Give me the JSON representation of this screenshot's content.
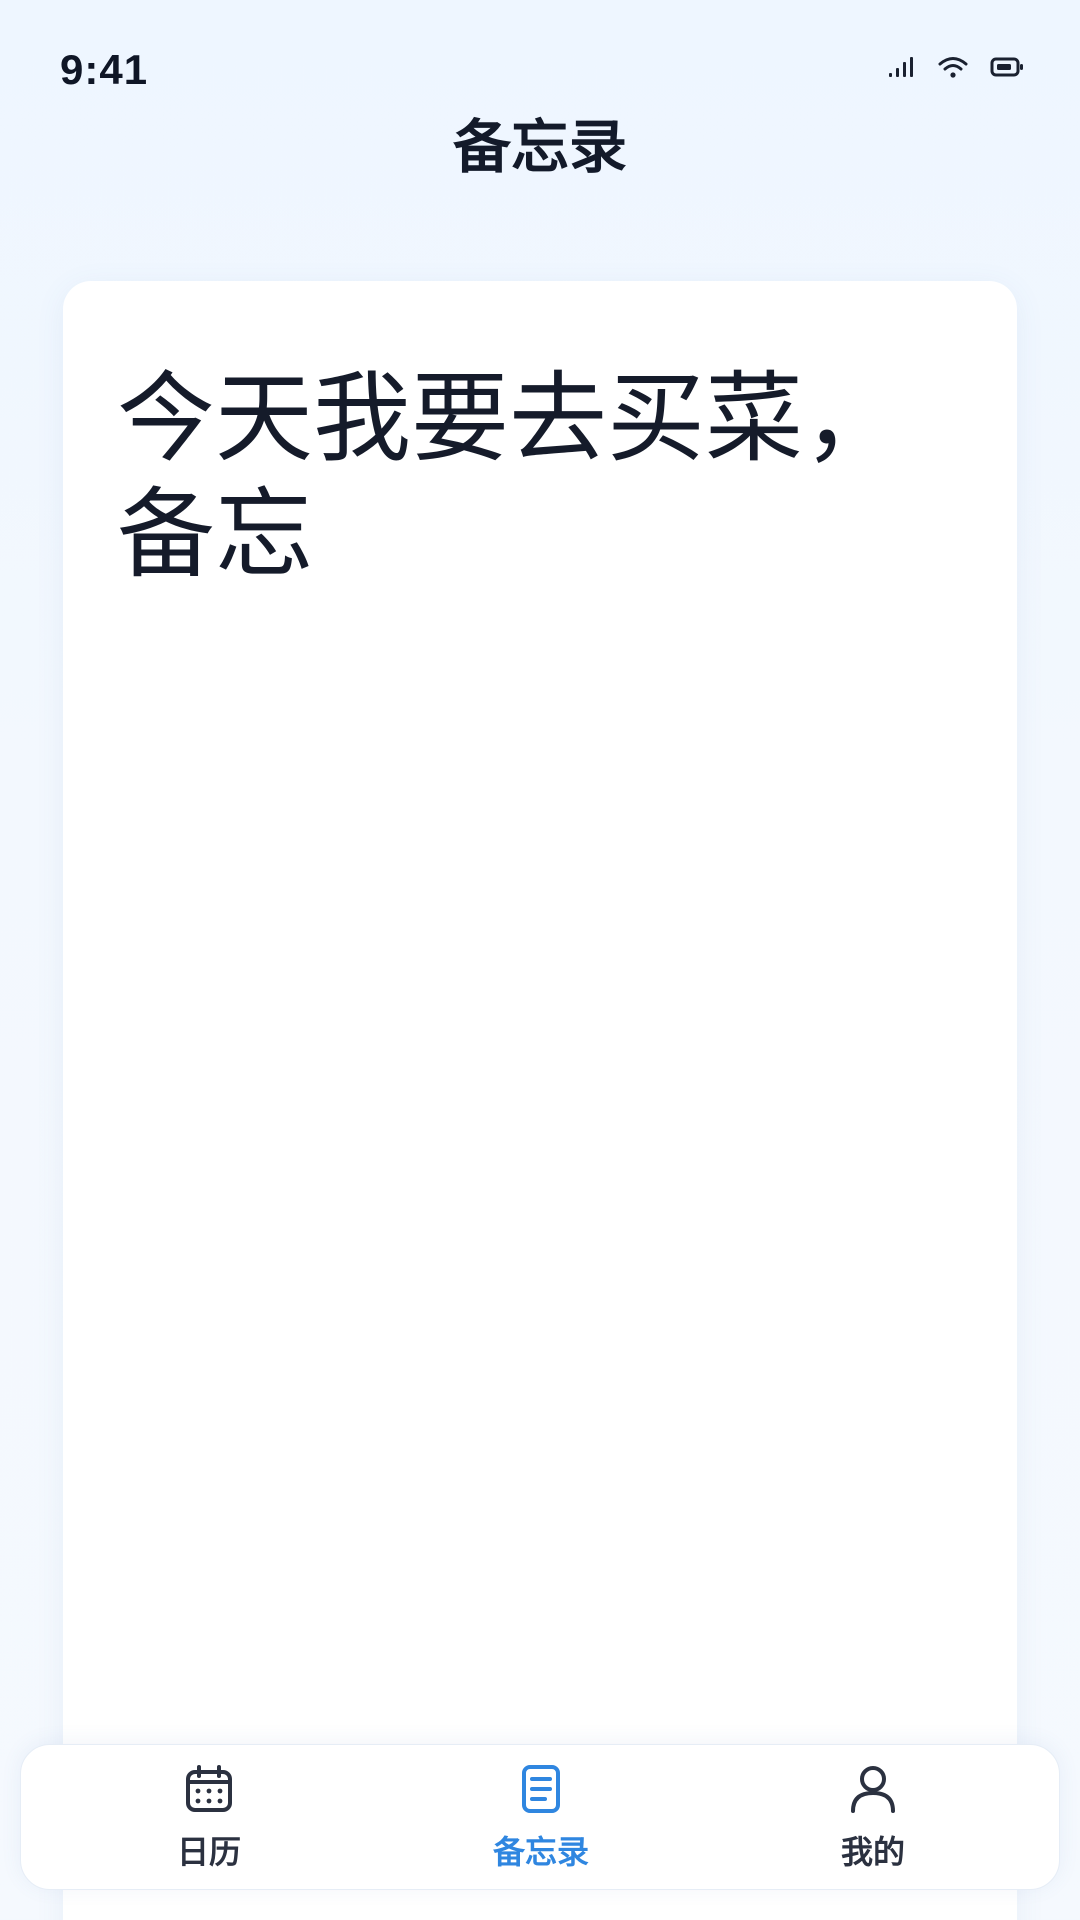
{
  "status_bar": {
    "time": "9:41",
    "icons": [
      "signal-icon",
      "wifi-icon",
      "battery-icon"
    ]
  },
  "header": {
    "title": "备忘录"
  },
  "note": {
    "content": "今天我要去买菜，备忘"
  },
  "tab_bar": {
    "items": [
      {
        "label": "日历",
        "icon": "calendar-icon",
        "active": false
      },
      {
        "label": "备忘录",
        "icon": "document-icon",
        "active": true
      },
      {
        "label": "我的",
        "icon": "person-icon",
        "active": false
      }
    ]
  },
  "colors": {
    "accent": "#2f86e0",
    "text": "#151b2a",
    "background": "#eef6ff",
    "card": "#ffffff"
  }
}
